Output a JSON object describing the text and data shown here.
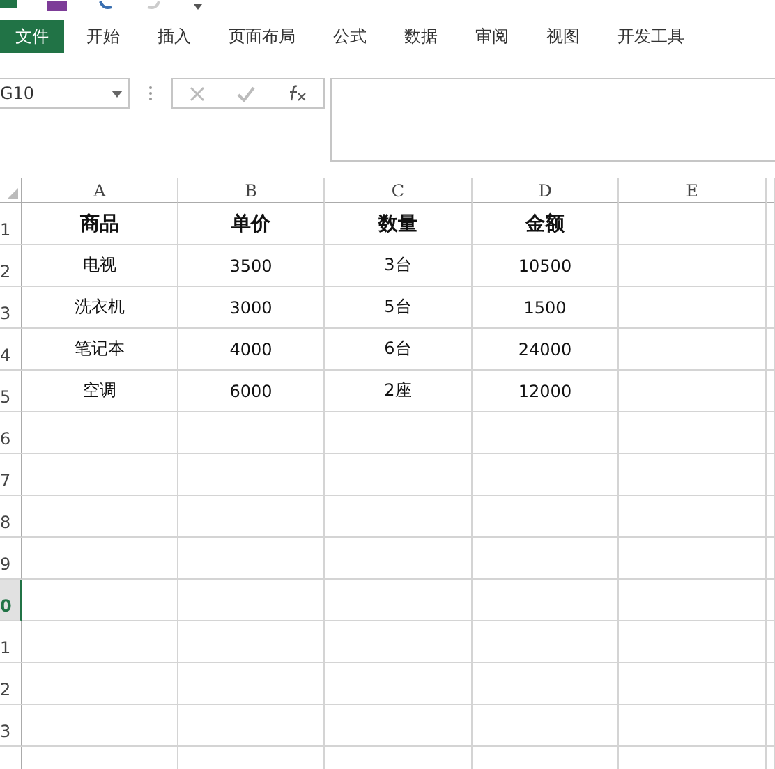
{
  "file_button": "文件",
  "ribbon_tabs": [
    {
      "label": "开始"
    },
    {
      "label": "插入"
    },
    {
      "label": "页面布局"
    },
    {
      "label": "公式"
    },
    {
      "label": "数据"
    },
    {
      "label": "审阅"
    },
    {
      "label": "视图"
    },
    {
      "label": "开发工具"
    }
  ],
  "name_box": {
    "value": "G10"
  },
  "columns": [
    "A",
    "B",
    "C",
    "D",
    "E"
  ],
  "rows": [
    {
      "label": "1",
      "selected": false,
      "bold": true,
      "cells": [
        "商品",
        "单价",
        "数量",
        "金额"
      ]
    },
    {
      "label": "2",
      "selected": false,
      "bold": false,
      "cells": [
        "电视",
        "3500",
        "3台",
        "10500"
      ]
    },
    {
      "label": "3",
      "selected": false,
      "bold": false,
      "cells": [
        "洗衣机",
        "3000",
        "5台",
        "1500"
      ]
    },
    {
      "label": "4",
      "selected": false,
      "bold": false,
      "cells": [
        "笔记本",
        "4000",
        "6台",
        "24000"
      ]
    },
    {
      "label": "5",
      "selected": false,
      "bold": false,
      "cells": [
        "空调",
        "6000",
        "2座",
        "12000"
      ]
    },
    {
      "label": "6",
      "selected": false
    },
    {
      "label": "7",
      "selected": false
    },
    {
      "label": "8",
      "selected": false
    },
    {
      "label": "9",
      "selected": false
    },
    {
      "label": "0",
      "selected": true
    },
    {
      "label": "1",
      "selected": false
    },
    {
      "label": "2",
      "selected": false
    },
    {
      "label": "3",
      "selected": false
    }
  ]
}
